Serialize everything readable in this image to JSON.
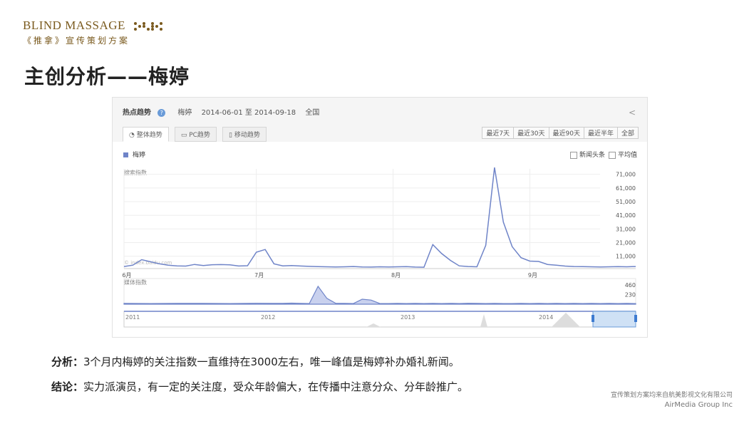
{
  "brand": {
    "name": "BLIND MASSAGE",
    "subtitle": "《推拿》宣传策划方案"
  },
  "page_title": "主创分析——梅婷",
  "panel": {
    "title": "热点趋势",
    "keyword": "梅婷",
    "date_range": "2014-06-01 至 2014-09-18",
    "region": "全国",
    "tabs": [
      "整体趋势",
      "PC趋势",
      "移动趋势"
    ],
    "ranges": [
      "最近7天",
      "最近30天",
      "最近90天",
      "最近半年",
      "全部"
    ],
    "legend": "梅婷",
    "checkbox_news": "新闻头条",
    "checkbox_avg": "平均值",
    "watermark": "© index.baidu.com"
  },
  "chart_data": [
    {
      "type": "line",
      "title": "",
      "ylabel": "搜索指数",
      "series_name": "梅婷",
      "color": "#6f84c8",
      "y_ticks": [
        11000,
        21000,
        31000,
        41000,
        51000,
        61000,
        71000
      ],
      "y_tick_labels": [
        "11,000",
        "21,000",
        "31,000",
        "41,000",
        "51,000",
        "61,000",
        "71,000"
      ],
      "ylim": [
        2000,
        75000
      ],
      "x_tick_labels": [
        "6月",
        "7月",
        "8月",
        "9月"
      ],
      "x_tick_days": [
        0,
        30,
        61,
        92
      ],
      "x_days": [
        0,
        2,
        4,
        6,
        8,
        10,
        12,
        14,
        16,
        18,
        20,
        22,
        24,
        26,
        28,
        30,
        32,
        34,
        36,
        38,
        40,
        42,
        44,
        46,
        48,
        50,
        52,
        54,
        56,
        58,
        60,
        62,
        64,
        66,
        68,
        70,
        72,
        74,
        76,
        78,
        80,
        82,
        84,
        86,
        88,
        90,
        92,
        94,
        96,
        98,
        100,
        102,
        104,
        106,
        108,
        110,
        112,
        114,
        116
      ],
      "values": [
        3500,
        4500,
        8500,
        7000,
        5500,
        4500,
        4000,
        3800,
        5000,
        4200,
        4800,
        4900,
        4700,
        3900,
        4100,
        14000,
        16000,
        5500,
        4000,
        4200,
        3900,
        3600,
        3400,
        3300,
        3200,
        3300,
        3500,
        3200,
        3100,
        3300,
        3200,
        3300,
        3400,
        3100,
        3000,
        19500,
        13000,
        8000,
        4000,
        3500,
        3300,
        19000,
        76000,
        36000,
        18000,
        10000,
        7500,
        7200,
        5000,
        4500,
        3800,
        3500,
        3400,
        3300,
        3200,
        3300,
        3400,
        3300,
        3500
      ],
      "xlim_days": [
        0,
        116
      ]
    },
    {
      "type": "area",
      "ylabel": "媒体指数",
      "series_name": "梅婷",
      "y_ticks": [
        230,
        460
      ],
      "y_tick_labels": [
        "230",
        "460"
      ],
      "ylim": [
        0,
        480
      ],
      "x_days": [
        0,
        6,
        12,
        18,
        24,
        30,
        36,
        38,
        40,
        42,
        44,
        46,
        48,
        50,
        52,
        54,
        56,
        58,
        60,
        62,
        64,
        66,
        68,
        70,
        72,
        74,
        76,
        78,
        80,
        82,
        84,
        86,
        88,
        90,
        92,
        94,
        96,
        98,
        100,
        102,
        104,
        106,
        108,
        110,
        112,
        114,
        116
      ],
      "values": [
        20,
        15,
        20,
        18,
        15,
        22,
        18,
        25,
        20,
        15,
        430,
        140,
        20,
        18,
        15,
        120,
        100,
        15,
        15,
        18,
        15,
        20,
        15,
        18,
        15,
        20,
        15,
        22,
        18,
        15,
        20,
        15,
        15,
        18,
        15,
        20,
        15,
        18,
        15,
        20,
        15,
        18,
        15,
        20,
        15,
        18,
        15
      ],
      "xlim_days": [
        0,
        116
      ]
    },
    {
      "type": "area",
      "title": "",
      "x_tick_labels": [
        "2011",
        "2012",
        "2013",
        "2014"
      ],
      "note": "overview navigator with selected window at end"
    }
  ],
  "caption": {
    "line1_label": "分析：",
    "line1_text": "3个月内梅婷的关注指数一直维持在3000左右，唯一峰值是梅婷补办婚礼新闻。",
    "line2_label": "结论：",
    "line2_text": "实力派演员，有一定的关注度，受众年龄偏大，在传播中注意分众、分年龄推广。"
  },
  "footer": {
    "line1": "宣传策划方案均来自航美影视文化有限公司",
    "line2": "AirMedia Group Inc"
  }
}
